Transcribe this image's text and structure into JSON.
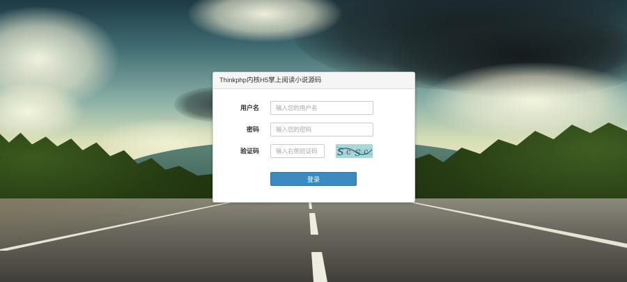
{
  "login": {
    "title": "Thinkphp内核H5掌上阅读小说源码",
    "username": {
      "label": "用户名",
      "placeholder": "输入您的用户名",
      "value": ""
    },
    "password": {
      "label": "密码",
      "placeholder": "输入您的密码",
      "value": ""
    },
    "captcha": {
      "label": "验证码",
      "placeholder": "输入右侧验证码",
      "value": "",
      "image_text": "ScSc"
    },
    "submit_label": "登录"
  },
  "colors": {
    "accent": "#3a8bc1",
    "card_header_bg": "#f5f5f5",
    "captcha_bg": "#a9d8d6"
  }
}
